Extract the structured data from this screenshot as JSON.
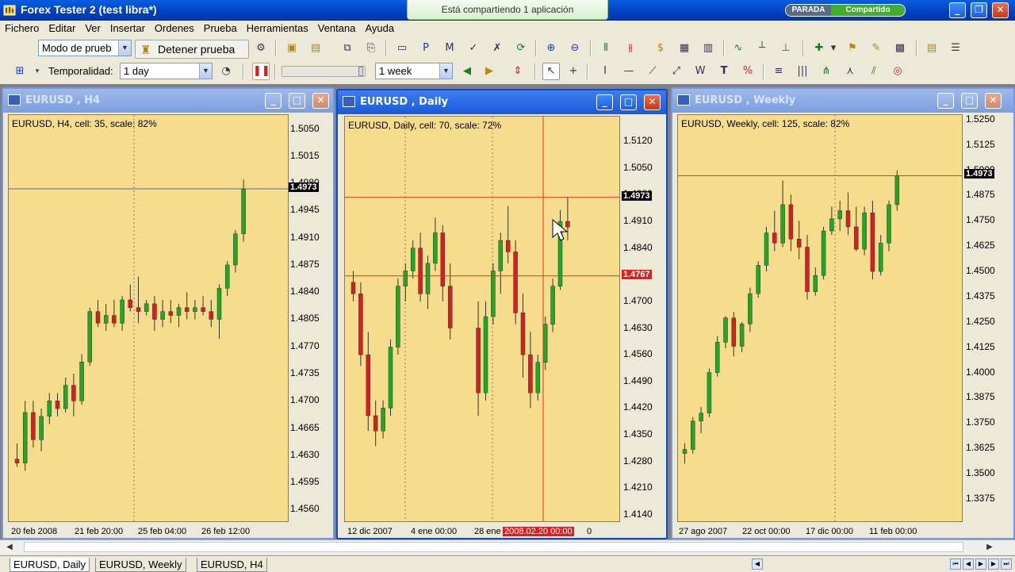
{
  "app": {
    "title": "Forex Tester 2  (test libra*)",
    "share_banner": "Está compartiendo 1 aplicación",
    "status_left": "PARADA",
    "status_right": "Compartido"
  },
  "menu": [
    "Fichero",
    "Editar",
    "Ver",
    "Insertar",
    "Ordenes",
    "Prueba",
    "Herramientas",
    "Ventana",
    "Ayuda"
  ],
  "toolbar": {
    "mode_value": "Modo de prueb",
    "stop_label": "Detener prueba",
    "timeframe_label": "Temporalidad:",
    "timeframe_value": "1 day",
    "step_value": "1 week"
  },
  "windows": [
    {
      "title": "EURUSD , H4",
      "info": "EURUSD, H4, cell: 35, scale: 82%",
      "prices": [
        "1.5050",
        "1.5015",
        "1.4980",
        "1.4945",
        "1.4910",
        "1.4875",
        "1.4840",
        "1.4805",
        "1.4770",
        "1.4735",
        "1.4700",
        "1.4665",
        "1.4630",
        "1.4595",
        "1.4560"
      ],
      "dates": [
        "20 feb 2008",
        "21 feb 20:00",
        "25 feb 04:00",
        "26 feb 12:00"
      ],
      "price_tag": "1.4973",
      "price_tag_value": 1.4973
    },
    {
      "title": "EURUSD , Daily",
      "info": "EURUSD, Daily, cell: 70, scale: 72%",
      "prices": [
        "1.5120",
        "1.5050",
        "1.4980",
        "1.4910",
        "1.4840",
        "1.4770",
        "1.4700",
        "1.4630",
        "1.4560",
        "1.4490",
        "1.4420",
        "1.4350",
        "1.4280",
        "1.4210",
        "1.4140"
      ],
      "dates": [
        "12 dic 2007",
        "4 ene 00:00",
        "28 ene"
      ],
      "crosshair_date": "2008.02.20 00:00",
      "crosshair_date_tail": "0",
      "price_tag": "1.4973",
      "price_tag_value": 1.4973,
      "crosshair_tag": "1.4767",
      "crosshair_tag_value": 1.4767
    },
    {
      "title": "EURUSD , Weekly",
      "info": "EURUSD, Weekly, cell: 125, scale: 82%",
      "prices": [
        "1.5250",
        "1.5125",
        "1.5000",
        "1.4875",
        "1.4750",
        "1.4625",
        "1.4500",
        "1.4375",
        "1.4250",
        "1.4125",
        "1.4000",
        "1.3875",
        "1.3750",
        "1.3625",
        "1.3500",
        "1.3375"
      ],
      "dates": [
        "27 ago 2007",
        "22 oct 00:00",
        "17 dic 00:00",
        "11 feb 00:00"
      ],
      "price_tag": "1.4973",
      "price_tag_value": 1.4973
    }
  ],
  "tabs": [
    "EURUSD, Daily",
    "EURUSD, Weekly",
    "EURUSD, H4"
  ],
  "colors": {
    "chart_bg": "#f6dd8d",
    "bull": "#22a722",
    "bear": "#d42020",
    "crosshair": "#e03020",
    "price_line": "#5070b0"
  },
  "chart_data": [
    {
      "type": "candlestick",
      "series": "EURUSD H4",
      "ylim": [
        1.4545,
        1.5068
      ],
      "candles": [
        [
          1.4625,
          1.4645,
          1.4615,
          1.462
        ],
        [
          1.462,
          1.47,
          1.461,
          1.4685
        ],
        [
          1.4685,
          1.47,
          1.464,
          1.465
        ],
        [
          1.465,
          1.469,
          1.4635,
          1.468
        ],
        [
          1.468,
          1.471,
          1.467,
          1.47
        ],
        [
          1.47,
          1.471,
          1.468,
          1.469
        ],
        [
          1.469,
          1.473,
          1.4685,
          1.472
        ],
        [
          1.472,
          1.4735,
          1.468,
          1.47
        ],
        [
          1.47,
          1.476,
          1.4695,
          1.475
        ],
        [
          1.475,
          1.482,
          1.4745,
          1.4815
        ],
        [
          1.4815,
          1.483,
          1.4795,
          1.48
        ],
        [
          1.48,
          1.4825,
          1.479,
          1.481
        ],
        [
          1.481,
          1.483,
          1.4795,
          1.48
        ],
        [
          1.48,
          1.4835,
          1.479,
          1.483
        ],
        [
          1.483,
          1.485,
          1.4815,
          1.482
        ],
        [
          1.482,
          1.486,
          1.48,
          1.4815
        ],
        [
          1.4815,
          1.483,
          1.481,
          1.4825
        ],
        [
          1.4825,
          1.4835,
          1.479,
          1.4805
        ],
        [
          1.4805,
          1.483,
          1.4795,
          1.4815
        ],
        [
          1.4815,
          1.483,
          1.48,
          1.481
        ],
        [
          1.481,
          1.4825,
          1.4795,
          1.482
        ],
        [
          1.482,
          1.484,
          1.4805,
          1.4815
        ],
        [
          1.4815,
          1.483,
          1.4805,
          1.482
        ],
        [
          1.482,
          1.4835,
          1.481,
          1.4815
        ],
        [
          1.4815,
          1.483,
          1.4795,
          1.4805
        ],
        [
          1.4805,
          1.485,
          1.478,
          1.4845
        ],
        [
          1.4845,
          1.488,
          1.4835,
          1.4875
        ],
        [
          1.4875,
          1.492,
          1.4865,
          1.4915
        ],
        [
          1.4915,
          1.4985,
          1.4905,
          1.4973
        ]
      ]
    },
    {
      "type": "candlestick",
      "series": "EURUSD Daily",
      "ylim": [
        1.4123,
        1.5185
      ],
      "candles": [
        [
          1.475,
          1.478,
          1.47,
          1.472
        ],
        [
          1.472,
          1.475,
          1.453,
          1.456
        ],
        [
          1.456,
          1.462,
          1.436,
          1.44
        ],
        [
          1.44,
          1.444,
          1.432,
          1.436
        ],
        [
          1.436,
          1.444,
          1.434,
          1.442
        ],
        [
          1.442,
          1.46,
          1.44,
          1.458
        ],
        [
          1.458,
          1.476,
          1.456,
          1.474
        ],
        [
          1.474,
          1.48,
          1.47,
          1.478
        ],
        [
          1.478,
          1.486,
          1.476,
          1.484
        ],
        [
          1.484,
          1.488,
          1.47,
          1.472
        ],
        [
          1.472,
          1.482,
          1.468,
          1.48
        ],
        [
          1.48,
          1.492,
          1.478,
          1.488
        ],
        [
          1.488,
          1.49,
          1.47,
          1.474
        ],
        [
          1.474,
          1.48,
          1.46,
          1.463
        ],
        [
          1.463,
          1.47,
          1.44,
          1.446
        ],
        [
          1.446,
          1.47,
          1.444,
          1.466
        ],
        [
          1.466,
          1.48,
          1.464,
          1.478
        ],
        [
          1.478,
          1.488,
          1.472,
          1.486
        ],
        [
          1.486,
          1.495,
          1.48,
          1.483
        ],
        [
          1.483,
          1.486,
          1.464,
          1.467
        ],
        [
          1.467,
          1.472,
          1.45,
          1.456
        ],
        [
          1.456,
          1.462,
          1.442,
          1.446
        ],
        [
          1.446,
          1.456,
          1.444,
          1.454
        ],
        [
          1.454,
          1.466,
          1.452,
          1.464
        ],
        [
          1.464,
          1.476,
          1.462,
          1.474
        ],
        [
          1.474,
          1.494,
          1.473,
          1.491
        ],
        [
          1.491,
          1.4973,
          1.486,
          1.4895
        ]
      ]
    },
    {
      "type": "candlestick",
      "series": "EURUSD Weekly",
      "ylim": [
        1.3265,
        1.5273
      ],
      "candles": [
        [
          1.36,
          1.365,
          1.355,
          1.362
        ],
        [
          1.362,
          1.378,
          1.36,
          1.376
        ],
        [
          1.376,
          1.383,
          1.37,
          1.38
        ],
        [
          1.38,
          1.402,
          1.378,
          1.4
        ],
        [
          1.4,
          1.418,
          1.398,
          1.415
        ],
        [
          1.415,
          1.428,
          1.412,
          1.427
        ],
        [
          1.427,
          1.43,
          1.408,
          1.413
        ],
        [
          1.413,
          1.425,
          1.41,
          1.424
        ],
        [
          1.424,
          1.442,
          1.42,
          1.439
        ],
        [
          1.439,
          1.455,
          1.437,
          1.453
        ],
        [
          1.453,
          1.472,
          1.45,
          1.469
        ],
        [
          1.469,
          1.48,
          1.46,
          1.464
        ],
        [
          1.464,
          1.495,
          1.462,
          1.483
        ],
        [
          1.483,
          1.488,
          1.46,
          1.466
        ],
        [
          1.466,
          1.475,
          1.456,
          1.462
        ],
        [
          1.462,
          1.468,
          1.436,
          1.44
        ],
        [
          1.44,
          1.452,
          1.438,
          1.448
        ],
        [
          1.448,
          1.472,
          1.446,
          1.47
        ],
        [
          1.47,
          1.482,
          1.468,
          1.476
        ],
        [
          1.476,
          1.485,
          1.47,
          1.48
        ],
        [
          1.48,
          1.489,
          1.468,
          1.472
        ],
        [
          1.472,
          1.482,
          1.46,
          1.461
        ],
        [
          1.461,
          1.482,
          1.458,
          1.479
        ],
        [
          1.479,
          1.485,
          1.446,
          1.45
        ],
        [
          1.45,
          1.468,
          1.448,
          1.464
        ],
        [
          1.464,
          1.485,
          1.46,
          1.483
        ],
        [
          1.483,
          1.5,
          1.48,
          1.4973
        ]
      ]
    }
  ]
}
